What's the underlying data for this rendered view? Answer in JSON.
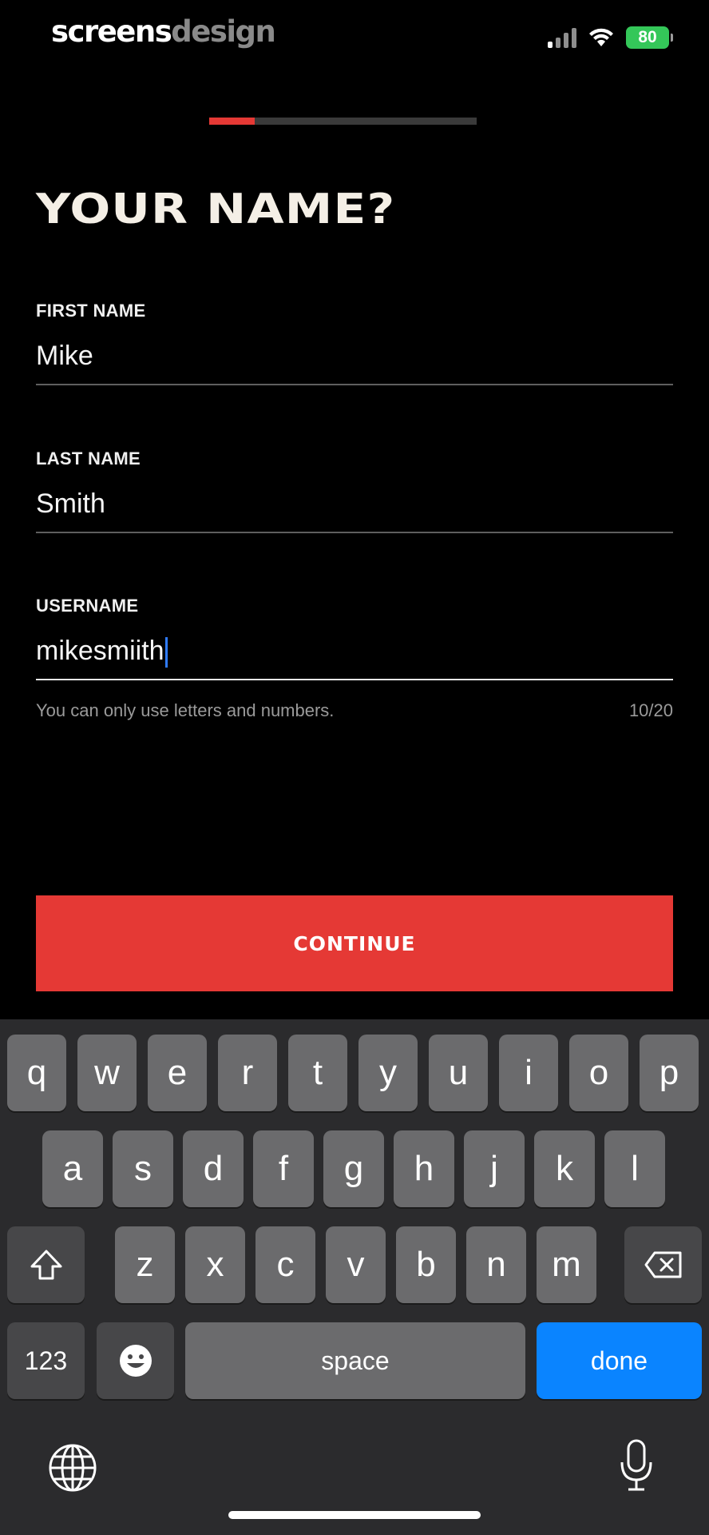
{
  "status_bar": {
    "logo_part1": "screens",
    "logo_part2": "design",
    "battery": "80"
  },
  "progress": {
    "fraction": 0.17
  },
  "title": "YOUR NAME?",
  "fields": [
    {
      "label": "FIRST NAME",
      "value": "Mike"
    },
    {
      "label": "LAST NAME",
      "value": "Smith"
    },
    {
      "label": "USERNAME",
      "value": "mikesmiith"
    }
  ],
  "hint": {
    "text": "You can only use letters and numbers.",
    "count": "10/20"
  },
  "continue_label": "CONTINUE",
  "keyboard": {
    "row1": [
      "q",
      "w",
      "e",
      "r",
      "t",
      "y",
      "u",
      "i",
      "o",
      "p"
    ],
    "row2": [
      "a",
      "s",
      "d",
      "f",
      "g",
      "h",
      "j",
      "k",
      "l"
    ],
    "row3": [
      "z",
      "x",
      "c",
      "v",
      "b",
      "n",
      "m"
    ],
    "numbers_key": "123",
    "space_key": "space",
    "done_key": "done"
  }
}
